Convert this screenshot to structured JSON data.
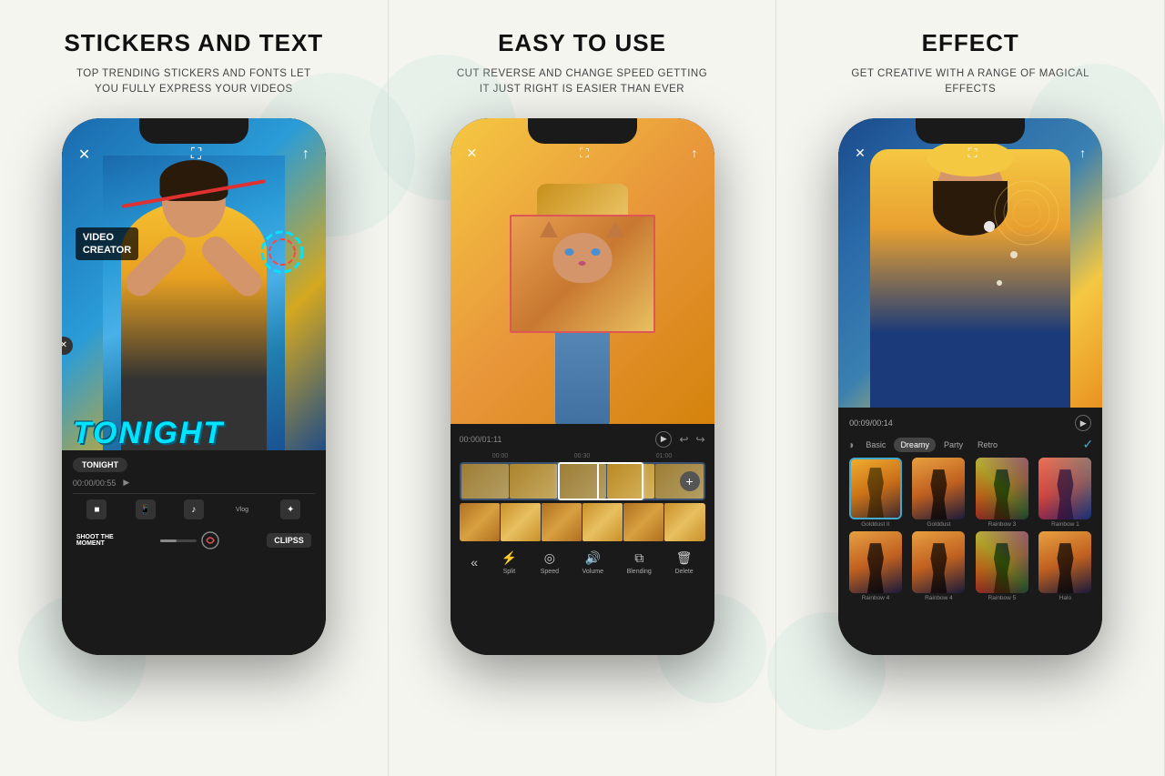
{
  "sections": [
    {
      "id": "stickers",
      "title": "STICKERS AND TEXT",
      "subtitle": "TOP TRENDING STICKERS AND FONTS LET YOU FULLY EXPRESS YOUR VIDEOS",
      "phone": {
        "sticker_text": "VIDEO\nCREATOR",
        "tonight_text": "TONIGHT",
        "tonight_tag": "TONIGHT",
        "timecode": "00:00/00:55",
        "tools": [
          "",
          "",
          "Vlog",
          ""
        ],
        "brand": "CLIPSS"
      }
    },
    {
      "id": "easy",
      "title": "EASY TO USE",
      "subtitle": "CUT REVERSE AND CHANGE SPEED GETTING IT JUST RIGHT IS EASIER THAN EVER",
      "phone": {
        "timecode": "00:00/01:11",
        "tools": [
          "Split",
          "Speed",
          "Volume",
          "Blending",
          "Delete"
        ]
      }
    },
    {
      "id": "effect",
      "title": "EFFECT",
      "subtitle": "GET CREATIVE WITH A RANGE OF MAGICAL EFFECTS",
      "phone": {
        "timecode": "00:09/00:14",
        "effect_tabs": [
          "Basic",
          "Dreamy",
          "Party",
          "Retro"
        ],
        "effects_row1": [
          "Golddust II",
          "Golddust",
          "Rainbow 3",
          "Rainbow 1"
        ],
        "effects_row2": [
          "Rainbow 4",
          "Rainbow 4",
          "Rainbow 5",
          "Halo"
        ]
      }
    }
  ]
}
